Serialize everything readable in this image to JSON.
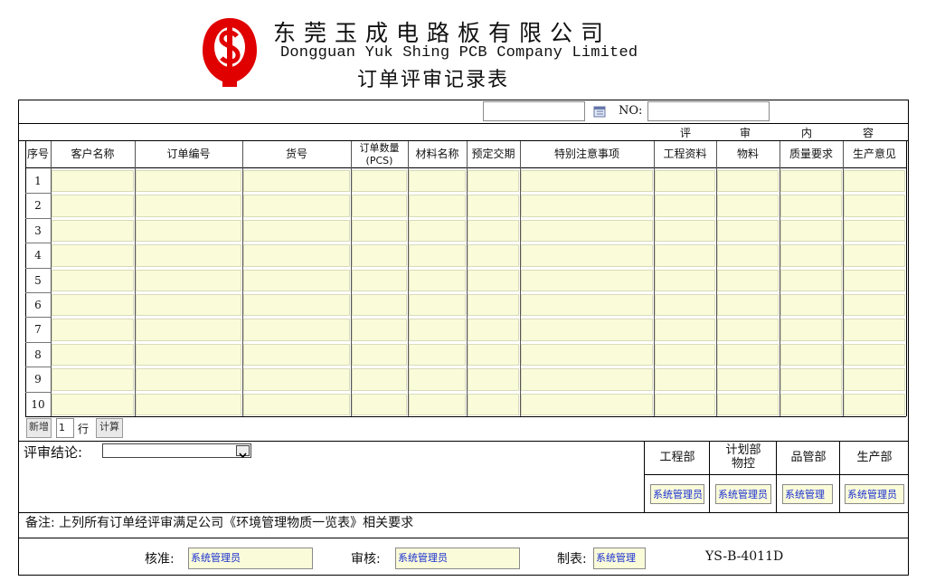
{
  "header": {
    "company_cn": "东莞玉成电路板有限公司",
    "company_en": "Dongguan Yuk Shing PCB Company Limited",
    "form_title": "订单评审记录表",
    "logo_icon": "company-logo-icon"
  },
  "top_row": {
    "no_label": "NO:",
    "date_value": "",
    "no_value": ""
  },
  "review_group": [
    "评",
    "审",
    "内",
    "容"
  ],
  "columns": [
    "序号",
    "客户名称",
    "订单编号",
    "货号",
    "订单数量\n(PCS)",
    "材料名称",
    "预定交期",
    "特别注意事项",
    "工程资料",
    "物料",
    "质量要求",
    "生产意见"
  ],
  "rows": [
    "1",
    "2",
    "3",
    "4",
    "5",
    "6",
    "7",
    "8",
    "9",
    "10"
  ],
  "add_row": {
    "add_label": "新增",
    "count_value": "1",
    "unit_label": "行",
    "calc_label": "计算"
  },
  "conclusion": {
    "label": "评审结论:",
    "selected": ""
  },
  "departments": [
    "工程部",
    "计划部\n物控",
    "品管部",
    "生产部"
  ],
  "dept_signers": [
    "系统管理员",
    "系统管理员",
    "系统管理",
    "系统管理员"
  ],
  "note": "备注: 上列所有订单经评审满足公司《环境管理物质一览表》相关要求",
  "footer": {
    "approve_label": "核准:",
    "approve_value": "系统管理员",
    "review_label": "审核:",
    "review_value": "系统管理员",
    "make_label": "制表:",
    "make_value": "系统管理",
    "doc_code": "YS-B-4011D"
  },
  "colors": {
    "cell_fill": "#fafbd9",
    "link_text": "#1a2fd0",
    "logo_red": "#e00000"
  }
}
